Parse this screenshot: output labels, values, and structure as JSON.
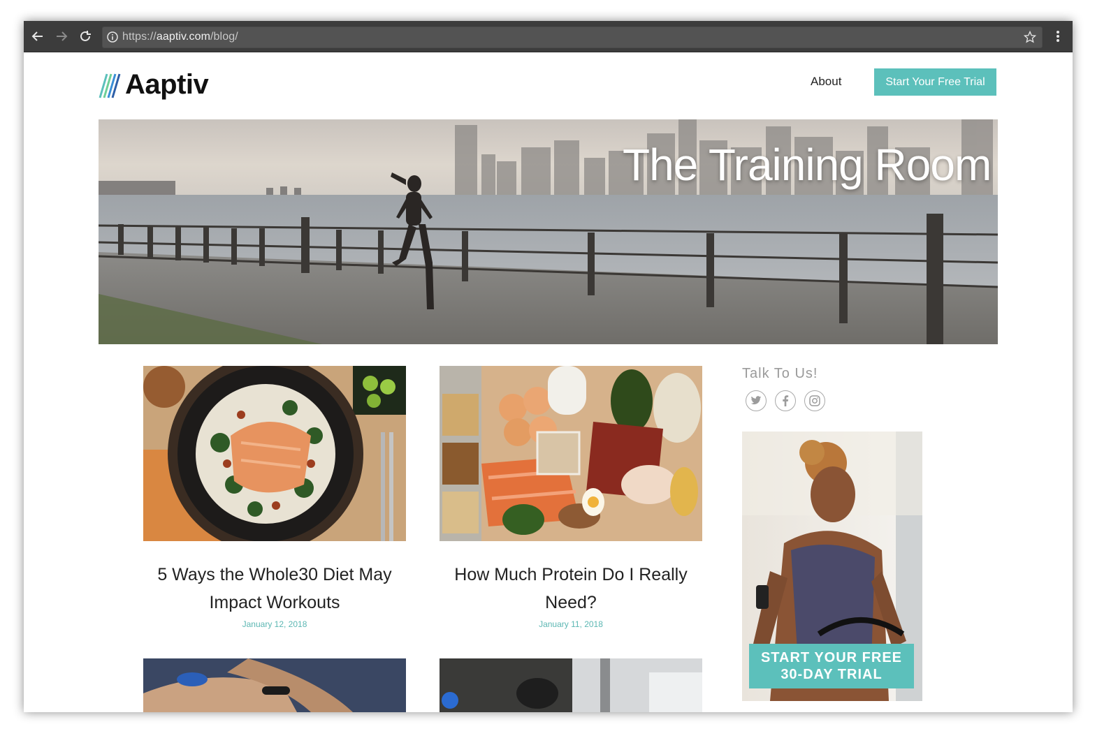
{
  "browser": {
    "url_scheme": "https://",
    "url_host": "aaptiv.com",
    "url_path": "/blog/",
    "icons": [
      "back-icon",
      "forward-icon",
      "reload-icon",
      "info-icon",
      "star-icon",
      "menu-icon"
    ]
  },
  "header": {
    "logo": "Aaptiv",
    "nav_about": "About",
    "cta": "Start Your Free Trial"
  },
  "hero": {
    "title": "The Training Room"
  },
  "posts": [
    {
      "title": "5 Ways the Whole30 Diet May Impact Workouts",
      "date": "January 12, 2018"
    },
    {
      "title": "How Much Protein Do I Really Need?",
      "date": "January 11, 2018"
    }
  ],
  "sidebar": {
    "heading": "Talk To Us!",
    "social": [
      "twitter-icon",
      "facebook-icon",
      "instagram-icon"
    ],
    "ad_line1": "START YOUR FREE",
    "ad_line2": "30-DAY TRIAL"
  },
  "colors": {
    "accent": "#5cc0bb",
    "chrome": "#3c3c3c"
  }
}
